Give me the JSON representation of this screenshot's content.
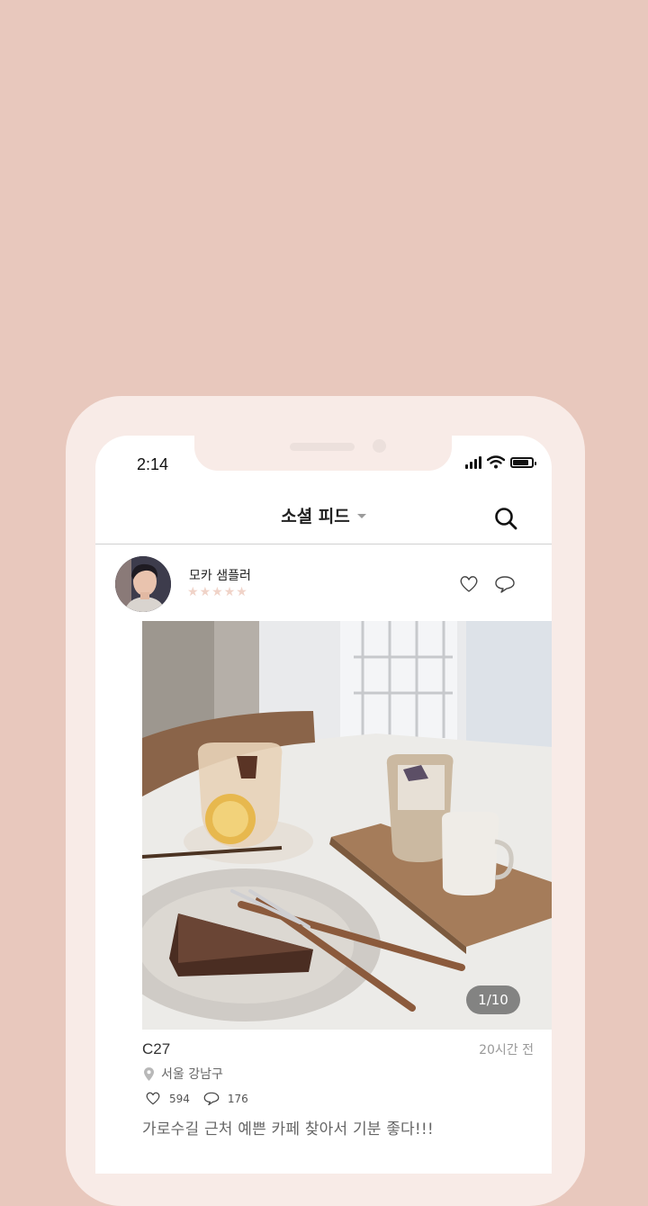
{
  "status_bar": {
    "time": "2:14",
    "battery_level": 0.85
  },
  "header": {
    "title": "소셜 피드",
    "search_icon": "search-icon",
    "dropdown_icon": "caret-down-icon"
  },
  "post": {
    "username": "모카 샘플러",
    "rating": 0,
    "rating_max": 5,
    "place": "C27",
    "time_ago": "20시간 전",
    "location": "서울 강남구",
    "likes": "594",
    "comments": "176",
    "caption": "가로수길 근처 예쁜 카페 찾아서 기분 좋다!!!",
    "photo_counter": "1/10"
  },
  "colors": {
    "background": "#e8c8bd",
    "frame": "#f8ebe7",
    "star_inactive": "#f0d3c8"
  }
}
